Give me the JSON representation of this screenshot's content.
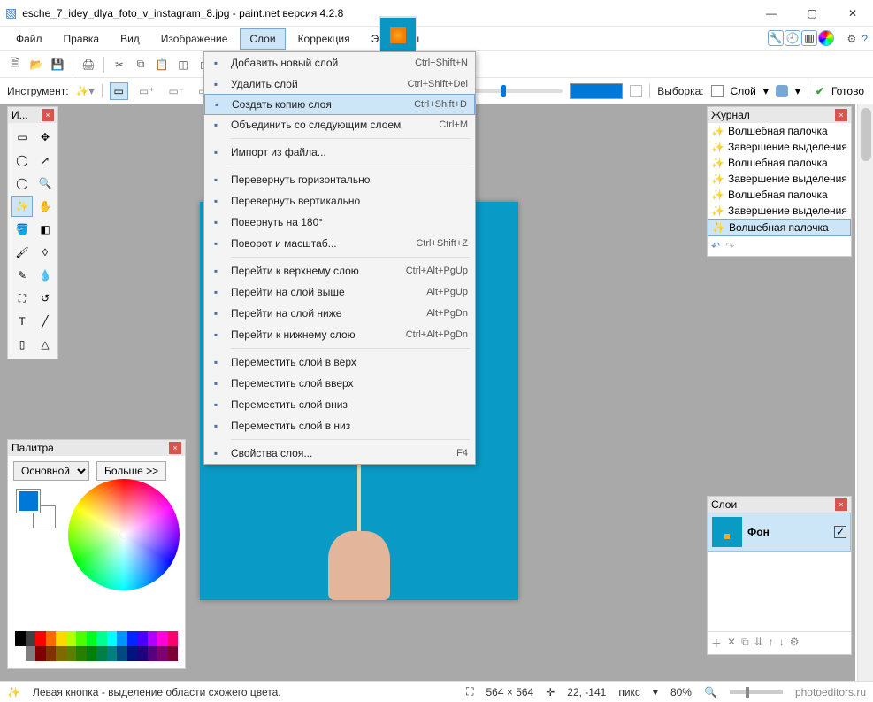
{
  "title": "esche_7_idey_dlya_foto_v_instagram_8.jpg - paint.net версия 4.2.8",
  "menu": {
    "file": "Файл",
    "edit": "Правка",
    "view": "Вид",
    "image": "Изображение",
    "layers": "Слои",
    "adjust": "Коррекция",
    "effects": "Эффекты"
  },
  "optbar": {
    "tool_label": "Инструмент:",
    "sample_label": "Выборка:",
    "sample_value": "Слой",
    "done": "Готово"
  },
  "dropdown": [
    {
      "label": "Добавить новый слой",
      "sc": "Ctrl+Shift+N"
    },
    {
      "label": "Удалить слой",
      "sc": "Ctrl+Shift+Del"
    },
    {
      "label": "Создать копию слоя",
      "sc": "Ctrl+Shift+D",
      "hover": true
    },
    {
      "label": "Объединить со следующим слоем",
      "sc": "Ctrl+M",
      "sep": true
    },
    {
      "label": "Импорт из файла...",
      "sc": "",
      "sep": true
    },
    {
      "label": "Перевернуть горизонтально",
      "sc": ""
    },
    {
      "label": "Перевернуть вертикально",
      "sc": ""
    },
    {
      "label": "Повернуть на 180°",
      "sc": ""
    },
    {
      "label": "Поворот и масштаб...",
      "sc": "Ctrl+Shift+Z",
      "sep": true
    },
    {
      "label": "Перейти к верхнему слою",
      "sc": "Ctrl+Alt+PgUp"
    },
    {
      "label": "Перейти на слой выше",
      "sc": "Alt+PgUp"
    },
    {
      "label": "Перейти на слой ниже",
      "sc": "Alt+PgDn"
    },
    {
      "label": "Перейти к нижнему слою",
      "sc": "Ctrl+Alt+PgDn",
      "sep": true
    },
    {
      "label": "Переместить слой в верх",
      "sc": ""
    },
    {
      "label": "Переместить слой вверх",
      "sc": ""
    },
    {
      "label": "Переместить слой вниз",
      "sc": ""
    },
    {
      "label": "Переместить слой в низ",
      "sc": "",
      "sep": true
    },
    {
      "label": "Свойства слоя...",
      "sc": "F4"
    }
  ],
  "tools_panel_title": "И...",
  "history": {
    "title": "Журнал",
    "items": [
      "Волшебная палочка",
      "Завершение выделения палочкой",
      "Волшебная палочка",
      "Завершение выделения палочкой",
      "Волшебная палочка",
      "Завершение выделения палочкой",
      "Волшебная палочка"
    ]
  },
  "layers": {
    "title": "Слои",
    "bg": "Фон"
  },
  "palette": {
    "title": "Палитра",
    "main": "Основной",
    "more": "Больше >>"
  },
  "status": {
    "hint": "Левая кнопка - выделение области схожего цвета.",
    "size": "564 × 564",
    "pos": "22, -141",
    "unit": "пикс",
    "zoom": "80%",
    "site": "photoeditors.ru"
  }
}
